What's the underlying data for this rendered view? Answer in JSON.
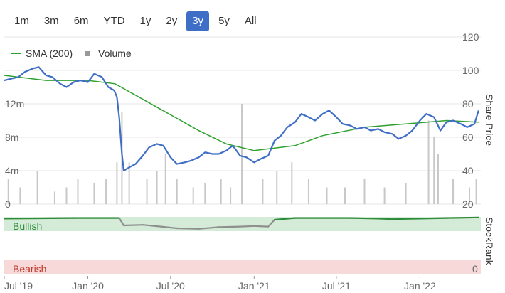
{
  "range_buttons": [
    "1m",
    "3m",
    "6m",
    "YTD",
    "1y",
    "2y",
    "3y",
    "5y",
    "All"
  ],
  "active_range": "3y",
  "colors": {
    "price": "#3f6ec7",
    "sma": "#2ea02e",
    "volume": "#c8c8c8",
    "bullish_band": "#d4ecd7",
    "bearish_band": "#f8d9da",
    "bullish_text": "#2e8b3a",
    "bearish_text": "#c0392b",
    "stockrank_bull": "#2e8b3a",
    "stockrank_bear": "#8f8f8f",
    "active_button": "#3f6ec7"
  },
  "chart_data": {
    "type": "line",
    "legend": [
      {
        "name": "SMA (200)",
        "marker": "line"
      },
      {
        "name": "Volume",
        "marker": "square"
      }
    ],
    "legend_position": "top-left",
    "price_axis": {
      "label": "Share Price",
      "ticks": [
        20,
        40,
        60,
        80,
        100,
        120
      ],
      "range": [
        20,
        120
      ],
      "position": "right"
    },
    "volume_axis": {
      "ticks": [
        "0",
        "4m",
        "8m",
        "12m"
      ],
      "values": [
        0,
        4,
        8,
        12
      ],
      "unit": "million",
      "range": [
        0,
        20
      ],
      "position": "left"
    },
    "x_axis": {
      "ticks": [
        "Jul '19",
        "Jan '20",
        "Jul '20",
        "Jan '21",
        "Jul '21",
        "Jan '22"
      ],
      "range": [
        "2019-07-01",
        "2022-05-15"
      ]
    },
    "series": [
      {
        "name": "Share Price",
        "points": [
          [
            "2019-07-01",
            94
          ],
          [
            "2019-07-15",
            95
          ],
          [
            "2019-08-01",
            96
          ],
          [
            "2019-08-15",
            99
          ],
          [
            "2019-09-01",
            101
          ],
          [
            "2019-09-15",
            102
          ],
          [
            "2019-10-01",
            97
          ],
          [
            "2019-10-15",
            96
          ],
          [
            "2019-11-01",
            92
          ],
          [
            "2019-11-15",
            90
          ],
          [
            "2019-12-01",
            93
          ],
          [
            "2019-12-15",
            94
          ],
          [
            "2020-01-01",
            93
          ],
          [
            "2020-01-15",
            98
          ],
          [
            "2020-02-01",
            96
          ],
          [
            "2020-02-15",
            90
          ],
          [
            "2020-02-28",
            88
          ],
          [
            "2020-03-05",
            84
          ],
          [
            "2020-03-10",
            72
          ],
          [
            "2020-03-16",
            50
          ],
          [
            "2020-03-20",
            40
          ],
          [
            "2020-04-01",
            42
          ],
          [
            "2020-04-15",
            44
          ],
          [
            "2020-05-01",
            49
          ],
          [
            "2020-05-15",
            54
          ],
          [
            "2020-06-01",
            56
          ],
          [
            "2020-06-15",
            55
          ],
          [
            "2020-07-01",
            48
          ],
          [
            "2020-07-15",
            44
          ],
          [
            "2020-08-01",
            45
          ],
          [
            "2020-08-15",
            46
          ],
          [
            "2020-09-01",
            48
          ],
          [
            "2020-09-15",
            51
          ],
          [
            "2020-10-01",
            50
          ],
          [
            "2020-10-15",
            50
          ],
          [
            "2020-11-01",
            52
          ],
          [
            "2020-11-15",
            55
          ],
          [
            "2020-12-01",
            49
          ],
          [
            "2020-12-15",
            48
          ],
          [
            "2021-01-01",
            45
          ],
          [
            "2021-01-15",
            47
          ],
          [
            "2021-02-01",
            49
          ],
          [
            "2021-02-15",
            58
          ],
          [
            "2021-03-01",
            61
          ],
          [
            "2021-03-15",
            66
          ],
          [
            "2021-04-01",
            69
          ],
          [
            "2021-04-15",
            74
          ],
          [
            "2021-05-01",
            72
          ],
          [
            "2021-05-15",
            70
          ],
          [
            "2021-06-01",
            74
          ],
          [
            "2021-06-15",
            76
          ],
          [
            "2021-07-01",
            72
          ],
          [
            "2021-07-15",
            68
          ],
          [
            "2021-08-01",
            67
          ],
          [
            "2021-08-15",
            65
          ],
          [
            "2021-09-01",
            66
          ],
          [
            "2021-09-15",
            64
          ],
          [
            "2021-10-01",
            65
          ],
          [
            "2021-10-15",
            63
          ],
          [
            "2021-11-01",
            62
          ],
          [
            "2021-11-15",
            59
          ],
          [
            "2021-12-01",
            61
          ],
          [
            "2021-12-15",
            64
          ],
          [
            "2022-01-01",
            70
          ],
          [
            "2022-01-15",
            74
          ],
          [
            "2022-02-01",
            72
          ],
          [
            "2022-02-15",
            64
          ],
          [
            "2022-02-28",
            69
          ],
          [
            "2022-03-15",
            70
          ],
          [
            "2022-04-01",
            68
          ],
          [
            "2022-04-15",
            66
          ],
          [
            "2022-05-01",
            68
          ],
          [
            "2022-05-10",
            76
          ]
        ]
      },
      {
        "name": "SMA (200)",
        "points": [
          [
            "2019-07-01",
            97
          ],
          [
            "2019-10-01",
            94
          ],
          [
            "2020-01-01",
            94
          ],
          [
            "2020-03-01",
            92
          ],
          [
            "2020-06-01",
            78
          ],
          [
            "2020-09-01",
            64
          ],
          [
            "2020-11-01",
            56
          ],
          [
            "2021-01-01",
            52
          ],
          [
            "2021-04-01",
            55
          ],
          [
            "2021-06-01",
            61
          ],
          [
            "2021-09-01",
            66
          ],
          [
            "2021-12-01",
            68
          ],
          [
            "2022-03-01",
            70
          ],
          [
            "2022-05-10",
            69
          ]
        ]
      }
    ],
    "volume": [
      [
        "2019-07-10",
        3
      ],
      [
        "2019-08-05",
        2
      ],
      [
        "2019-09-12",
        4
      ],
      [
        "2019-10-20",
        1.5
      ],
      [
        "2019-11-15",
        2
      ],
      [
        "2019-12-10",
        3
      ],
      [
        "2020-01-15",
        2.5
      ],
      [
        "2020-02-10",
        3
      ],
      [
        "2020-03-05",
        5
      ],
      [
        "2020-03-16",
        11
      ],
      [
        "2020-04-01",
        5
      ],
      [
        "2020-05-10",
        3
      ],
      [
        "2020-06-01",
        4
      ],
      [
        "2020-06-20",
        6
      ],
      [
        "2020-07-15",
        3
      ],
      [
        "2020-08-20",
        2
      ],
      [
        "2020-09-15",
        2.5
      ],
      [
        "2020-10-20",
        3
      ],
      [
        "2020-11-10",
        2
      ],
      [
        "2020-12-05",
        12
      ],
      [
        "2021-01-20",
        3
      ],
      [
        "2021-02-20",
        4
      ],
      [
        "2021-03-25",
        5
      ],
      [
        "2021-05-01",
        3
      ],
      [
        "2021-06-10",
        2
      ],
      [
        "2021-07-20",
        2
      ],
      [
        "2021-09-01",
        3
      ],
      [
        "2021-10-15",
        2
      ],
      [
        "2021-12-01",
        2.5
      ],
      [
        "2022-01-20",
        10
      ],
      [
        "2022-02-01",
        8
      ],
      [
        "2022-02-10",
        6
      ],
      [
        "2022-03-15",
        3
      ],
      [
        "2022-04-20",
        2
      ],
      [
        "2022-05-05",
        3
      ]
    ],
    "stockrank": {
      "label": "StockRank",
      "axis_ticks": [
        "0"
      ],
      "bands": [
        "Bullish",
        "Bearish"
      ],
      "range": [
        0,
        100
      ],
      "points": [
        [
          "2019-07-01",
          97
        ],
        [
          "2019-12-01",
          98
        ],
        [
          "2020-03-10",
          98
        ],
        [
          "2020-03-20",
          85
        ],
        [
          "2020-05-01",
          86
        ],
        [
          "2020-06-10",
          83
        ],
        [
          "2020-07-15",
          80
        ],
        [
          "2020-09-01",
          79
        ],
        [
          "2020-10-15",
          82
        ],
        [
          "2020-12-01",
          83
        ],
        [
          "2021-01-01",
          84
        ],
        [
          "2021-02-01",
          83
        ],
        [
          "2021-02-15",
          95
        ],
        [
          "2021-04-01",
          98
        ],
        [
          "2021-08-01",
          98
        ],
        [
          "2021-10-01",
          97
        ],
        [
          "2021-11-01",
          96
        ],
        [
          "2022-01-01",
          97
        ],
        [
          "2022-03-01",
          98
        ],
        [
          "2022-05-10",
          99
        ]
      ]
    }
  }
}
